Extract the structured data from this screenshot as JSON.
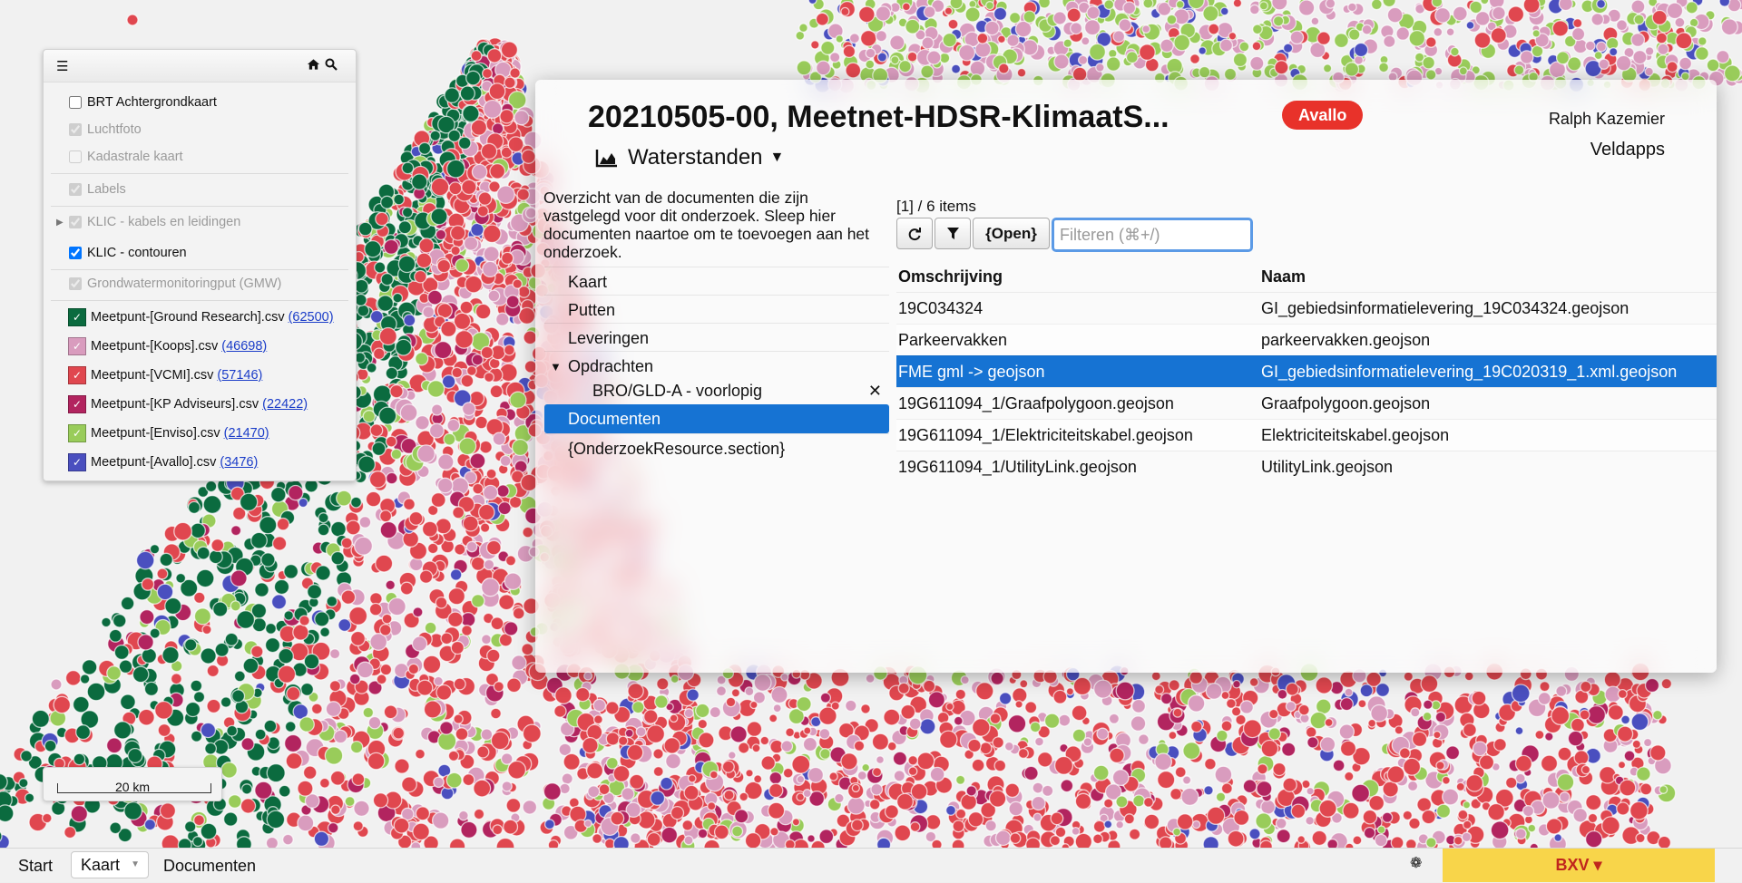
{
  "layers": {
    "items": [
      {
        "label": "BRT Achtergrondkaart",
        "checked": false,
        "dim": false
      },
      {
        "label": "Luchtfoto",
        "checked": true,
        "dim": true
      },
      {
        "label": "Kadastrale kaart",
        "checked": false,
        "dim": true
      },
      {
        "label": "Labels",
        "checked": true,
        "dim": true
      },
      {
        "label": "KLIC - kabels en leidingen",
        "checked": true,
        "dim": true,
        "expandable": true
      },
      {
        "label": "KLIC - contouren",
        "checked": true,
        "dim": false
      },
      {
        "label": "Grondwatermonitoringput (GMW)",
        "checked": true,
        "dim": true
      }
    ],
    "datasets": [
      {
        "label": "Meetpunt-[Ground Research].csv",
        "count": "(62500)",
        "color": "#0b6b3f"
      },
      {
        "label": "Meetpunt-[Koops].csv",
        "count": "(46698)",
        "color": "#d99cbe"
      },
      {
        "label": "Meetpunt-[VCMI].csv",
        "count": "(57146)",
        "color": "#e0474f"
      },
      {
        "label": "Meetpunt-[KP Adviseurs].csv",
        "count": "(22422)",
        "color": "#b2245f"
      },
      {
        "label": "Meetpunt-[Enviso].csv",
        "count": "(21470)",
        "color": "#99cc5a"
      },
      {
        "label": "Meetpunt-[Avallo].csv",
        "count": "(3476)",
        "color": "#4a4fbf"
      }
    ]
  },
  "scale": {
    "label": "20 km"
  },
  "dialog": {
    "title": "20210505-00, Meetnet-HDSR-KlimaatS...",
    "badge": "Avallo",
    "user": "Ralph Kazemier",
    "org": "Veldapps",
    "chart_selector": "Waterstanden",
    "description": "Overzicht van de documenten die zijn vastgelegd voor dit onderzoek. Sleep hier documenten naartoe om te toevoegen aan het onderzoek.",
    "nav": {
      "kaart": "Kaart",
      "putten": "Putten",
      "leveringen": "Leveringen",
      "opdrachten": "Opdrachten",
      "bro": "BRO/GLD-A - voorlopig",
      "documenten": "Documenten",
      "section": "{OnderzoekResource.section}"
    },
    "count": "[1] / 6 items",
    "open_label": "{Open}",
    "filter_placeholder": "Filteren (⌘+/)",
    "columns": {
      "omschrijving": "Omschrijving",
      "naam": "Naam"
    },
    "rows": [
      {
        "omschrijving": "19C034324",
        "naam": "GI_gebiedsinformatielevering_19C034324.geojson"
      },
      {
        "omschrijving": "Parkeervakken",
        "naam": "parkeervakken.geojson"
      },
      {
        "omschrijving": "FME gml -> geojson",
        "naam": "GI_gebiedsinformatielevering_19C020319_1.xml.geojson"
      },
      {
        "omschrijving": "19G611094_1/Graafpolygoon.geojson",
        "naam": "Graafpolygoon.geojson"
      },
      {
        "omschrijving": "19G611094_1/Elektriciteitskabel.geojson",
        "naam": "Elektriciteitskabel.geojson"
      },
      {
        "omschrijving": "19G611094_1/UtilityLink.geojson",
        "naam": "UtilityLink.geojson"
      }
    ]
  },
  "bottom": {
    "start": "Start",
    "kaart": "Kaart",
    "documenten": "Documenten",
    "bxv": "BXV ▾"
  }
}
